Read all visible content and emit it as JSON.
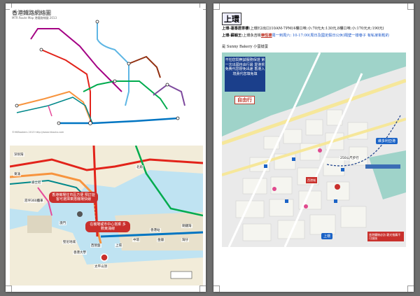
{
  "left_page": {
    "mtr_map": {
      "title": "香港鐵路網絡圖",
      "subtitle": "MTR Route Map 港鐵路線圖 2013",
      "credit": "©HKBookers 2013 http://www.hkauto.com"
    },
    "zoom_map": {
      "callout_1": "香港機場往市區方便 預訂遊客可選擇乘搭機場快線",
      "callout_2": "在機場或市中心搭乘 多數東涌線",
      "places": [
        "北角",
        "香港站",
        "中環",
        "金鐘",
        "灣仔",
        "銅鑼灣",
        "上環",
        "西營盤",
        "香港大學",
        "堅尼地城",
        "太平山頂",
        "澳門",
        "深圳灣",
        "東涌",
        "昂坪360纜車",
        "迪士尼"
      ]
    }
  },
  "right_page": {
    "heading": "上環",
    "line1_label": "上環-蓮香居茶樓",
    "line1_text": "(上環E2出口)10AM-7PM(4樓口味:小:70元大:130元,8樓口味:小:170元大:190元)",
    "line2_label": "上環-蘇蝦王:",
    "line2_text": "上環永吉街",
    "line2_hl": "樂恆樓",
    "line2_rest": "周一到周六: 10-17:00(周日及國定假日公休)隔壁一樣巷子 有私家街鬆的",
    "line3": "是 Sunny Bakery 小蛋撻蛋",
    "map": {
      "ad_text": "不怕您問無誠服務保證 第一次出國自由行最 愛港貿免費代您辦免出差 香港入境責代您填免填",
      "hotel": "自由行",
      "badge": "維多利亞港",
      "note_red": "西港城",
      "bottom_note": "香港購物必訪 觀光推薦不可錯過",
      "walk_label": "250公尺步行",
      "station": "上環"
    }
  },
  "colors": {
    "island_line": "#0075c2",
    "tsuen_wan_line": "#e2231a",
    "tung_chung_line": "#f7943e",
    "airport_express": "#00888a",
    "east_rail": "#5eb6e4",
    "kwun_tong": "#00ab4e",
    "west_rail": "#a40084",
    "tseung_kwan_o": "#7d499d",
    "ma_on_shan": "#923011"
  }
}
